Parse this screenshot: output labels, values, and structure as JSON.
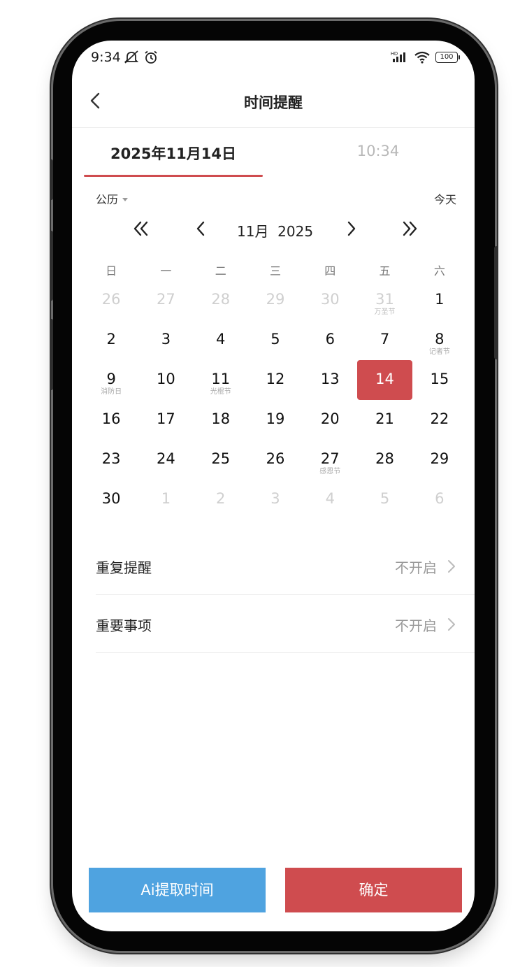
{
  "status_bar": {
    "time": "9:34",
    "battery": "100",
    "network": "HD"
  },
  "header": {
    "title": "时间提醒"
  },
  "tabs": {
    "date": "2025年11月14日",
    "time": "10:34"
  },
  "calendar_bar": {
    "mode": "公历",
    "today": "今天"
  },
  "month_nav": {
    "month": "11月",
    "year": "2025"
  },
  "weekdays": [
    "日",
    "一",
    "二",
    "三",
    "四",
    "五",
    "六"
  ],
  "calendar": {
    "selected_day": "14",
    "weeks": [
      [
        {
          "d": "26",
          "s": "",
          "other": true
        },
        {
          "d": "27",
          "s": "",
          "other": true
        },
        {
          "d": "28",
          "s": "",
          "other": true
        },
        {
          "d": "29",
          "s": "",
          "other": true
        },
        {
          "d": "30",
          "s": "",
          "other": true
        },
        {
          "d": "31",
          "s": "万圣节",
          "other": true
        },
        {
          "d": "1",
          "s": "",
          "other": false
        }
      ],
      [
        {
          "d": "2",
          "s": "",
          "other": false
        },
        {
          "d": "3",
          "s": "",
          "other": false
        },
        {
          "d": "4",
          "s": "",
          "other": false
        },
        {
          "d": "5",
          "s": "",
          "other": false
        },
        {
          "d": "6",
          "s": "",
          "other": false
        },
        {
          "d": "7",
          "s": "",
          "other": false
        },
        {
          "d": "8",
          "s": "记者节",
          "other": false
        }
      ],
      [
        {
          "d": "9",
          "s": "消防日",
          "other": false
        },
        {
          "d": "10",
          "s": "",
          "other": false
        },
        {
          "d": "11",
          "s": "光棍节",
          "other": false
        },
        {
          "d": "12",
          "s": "",
          "other": false
        },
        {
          "d": "13",
          "s": "",
          "other": false
        },
        {
          "d": "14",
          "s": "",
          "other": false,
          "selected": true
        },
        {
          "d": "15",
          "s": "",
          "other": false
        }
      ],
      [
        {
          "d": "16",
          "s": "",
          "other": false
        },
        {
          "d": "17",
          "s": "",
          "other": false
        },
        {
          "d": "18",
          "s": "",
          "other": false
        },
        {
          "d": "19",
          "s": "",
          "other": false
        },
        {
          "d": "20",
          "s": "",
          "other": false
        },
        {
          "d": "21",
          "s": "",
          "other": false
        },
        {
          "d": "22",
          "s": "",
          "other": false
        }
      ],
      [
        {
          "d": "23",
          "s": "",
          "other": false
        },
        {
          "d": "24",
          "s": "",
          "other": false
        },
        {
          "d": "25",
          "s": "",
          "other": false
        },
        {
          "d": "26",
          "s": "",
          "other": false
        },
        {
          "d": "27",
          "s": "感恩节",
          "other": false
        },
        {
          "d": "28",
          "s": "",
          "other": false
        },
        {
          "d": "29",
          "s": "",
          "other": false
        }
      ],
      [
        {
          "d": "30",
          "s": "",
          "other": false
        },
        {
          "d": "1",
          "s": "",
          "other": true
        },
        {
          "d": "2",
          "s": "",
          "other": true
        },
        {
          "d": "3",
          "s": "",
          "other": true
        },
        {
          "d": "4",
          "s": "",
          "other": true
        },
        {
          "d": "5",
          "s": "",
          "other": true
        },
        {
          "d": "6",
          "s": "",
          "other": true
        }
      ]
    ]
  },
  "settings": [
    {
      "label": "重复提醒",
      "value": "不开启"
    },
    {
      "label": "重要事项",
      "value": "不开启"
    }
  ],
  "buttons": {
    "ai": "Ai提取时间",
    "confirm": "确定"
  },
  "colors": {
    "accent_red": "#cf4c4f",
    "accent_blue": "#4fa3e0"
  }
}
